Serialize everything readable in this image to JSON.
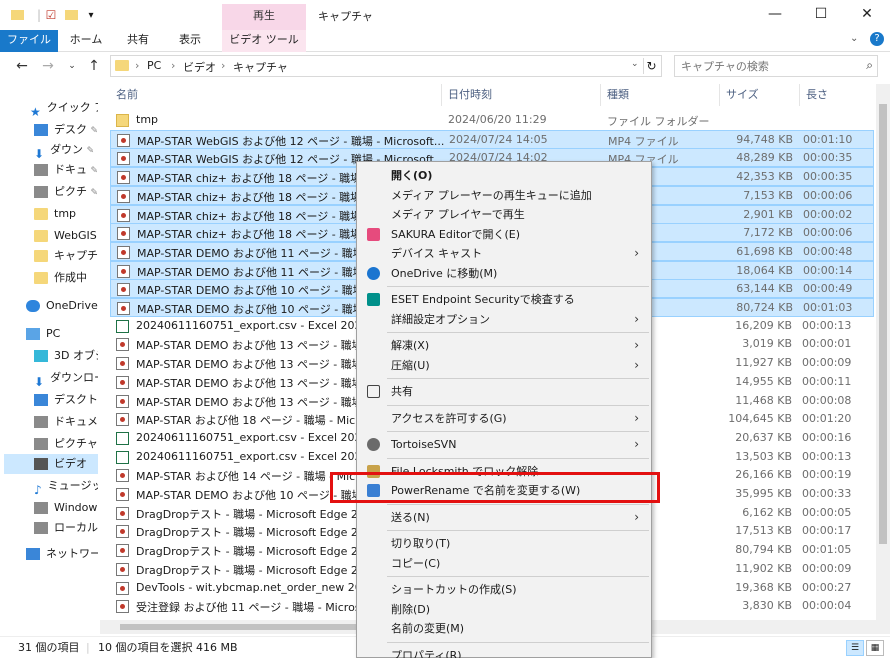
{
  "titlebar": {
    "title": "キャプチャ",
    "context_tab": "再生",
    "minimize": "—",
    "maximize": "☐",
    "close": "✕"
  },
  "ribbon": {
    "tabs": [
      "ファイル",
      "ホーム",
      "共有",
      "表示",
      "ビデオ ツール"
    ]
  },
  "address": {
    "crumbs": [
      "PC",
      "ビデオ",
      "キャプチャ"
    ],
    "search_placeholder": "キャプチャの検索"
  },
  "navpane": {
    "items": [
      {
        "label": "クイック ア",
        "icon": "star-icon"
      },
      {
        "label": "デスク",
        "icon": "desktop-icon"
      },
      {
        "label": "ダウン",
        "icon": "download-icon"
      },
      {
        "label": "ドキュ",
        "icon": "document-icon"
      },
      {
        "label": "ピクチ",
        "icon": "picture-icon"
      },
      {
        "label": "tmp",
        "icon": "folder-icon"
      },
      {
        "label": "WebGIS",
        "icon": "folder-icon"
      },
      {
        "label": "キャプチ",
        "icon": "folder-icon"
      },
      {
        "label": "作成中",
        "icon": "folder-icon"
      },
      {
        "label": "OneDrive",
        "icon": "onedrive-icon"
      },
      {
        "label": "PC",
        "icon": "pc-icon"
      },
      {
        "label": "3D オブジ",
        "icon": "cube-icon"
      },
      {
        "label": "ダウンロー",
        "icon": "download-icon"
      },
      {
        "label": "デスクトッ",
        "icon": "desktop-icon"
      },
      {
        "label": "ドキュメン",
        "icon": "document-icon"
      },
      {
        "label": "ピクチャ",
        "icon": "picture-icon"
      },
      {
        "label": "ビデオ",
        "icon": "video-icon"
      },
      {
        "label": "ミュージッ",
        "icon": "music-icon"
      },
      {
        "label": "Window",
        "icon": "drive-icon"
      },
      {
        "label": "ローカル",
        "icon": "drive-icon"
      },
      {
        "label": "ネットワーク",
        "icon": "network-icon"
      }
    ]
  },
  "columns": {
    "name": "名前",
    "date": "日付時刻",
    "type": "種類",
    "size": "サイズ",
    "length": "長さ"
  },
  "files": [
    {
      "name": "tmp",
      "date": "2024/06/20 11:29",
      "type": "ファイル フォルダー",
      "size": "",
      "len": "",
      "kind": "dir",
      "sel": false
    },
    {
      "name": "MAP-STAR WebGIS および他 12 ページ - 職場 - Microsoft...",
      "date": "2024/07/24 14:05",
      "type": "MP4 ファイル",
      "size": "94,748 KB",
      "len": "00:01:10",
      "kind": "mp4",
      "sel": true
    },
    {
      "name": "MAP-STAR WebGIS および他 12 ページ - 職場 - Microsoft...",
      "date": "2024/07/24 14:02",
      "type": "MP4 ファイル",
      "size": "48,289 KB",
      "len": "00:00:35",
      "kind": "mp4",
      "sel": true
    },
    {
      "name": "MAP-STAR chiz+ および他 18 ページ - 職場",
      "date": "",
      "type": "イル",
      "size": "42,353 KB",
      "len": "00:00:35",
      "kind": "mp4",
      "sel": true
    },
    {
      "name": "MAP-STAR chiz+ および他 18 ページ - 職場",
      "date": "",
      "type": "イル",
      "size": "7,153 KB",
      "len": "00:00:06",
      "kind": "mp4",
      "sel": true
    },
    {
      "name": "MAP-STAR chiz+ および他 18 ページ - 職場",
      "date": "",
      "type": "イル",
      "size": "2,901 KB",
      "len": "00:00:02",
      "kind": "mp4",
      "sel": true
    },
    {
      "name": "MAP-STAR chiz+ および他 18 ページ - 職場",
      "date": "",
      "type": "イル",
      "size": "7,172 KB",
      "len": "00:00:06",
      "kind": "mp4",
      "sel": true
    },
    {
      "name": "MAP-STAR DEMO および他 11 ページ - 職場",
      "date": "",
      "type": "イル",
      "size": "61,698 KB",
      "len": "00:00:48",
      "kind": "mp4",
      "sel": true
    },
    {
      "name": "MAP-STAR DEMO および他 11 ページ - 職場",
      "date": "",
      "type": "イル",
      "size": "18,064 KB",
      "len": "00:00:14",
      "kind": "mp4",
      "sel": true
    },
    {
      "name": "MAP-STAR DEMO および他 10 ページ - 職場",
      "date": "",
      "type": "イル",
      "size": "63,144 KB",
      "len": "00:00:49",
      "kind": "mp4",
      "sel": true
    },
    {
      "name": "MAP-STAR DEMO および他 10 ページ - 職場",
      "date": "",
      "type": "イル",
      "size": "80,724 KB",
      "len": "00:01:03",
      "kind": "mp4",
      "sel": true
    },
    {
      "name": "20240611160751_export.csv - Excel 2024-0",
      "date": "",
      "type": "イル",
      "size": "16,209 KB",
      "len": "00:00:13",
      "kind": "csv",
      "sel": false
    },
    {
      "name": "MAP-STAR DEMO および他 13 ページ - 職場",
      "date": "",
      "type": "イル",
      "size": "3,019 KB",
      "len": "00:00:01",
      "kind": "mp4",
      "sel": false
    },
    {
      "name": "MAP-STAR DEMO および他 13 ページ - 職場",
      "date": "",
      "type": "イル",
      "size": "11,927 KB",
      "len": "00:00:09",
      "kind": "mp4",
      "sel": false
    },
    {
      "name": "MAP-STAR DEMO および他 13 ページ - 職場",
      "date": "",
      "type": "イル",
      "size": "14,955 KB",
      "len": "00:00:11",
      "kind": "mp4",
      "sel": false
    },
    {
      "name": "MAP-STAR DEMO および他 13 ページ - 職場",
      "date": "",
      "type": "イル",
      "size": "11,468 KB",
      "len": "00:00:08",
      "kind": "mp4",
      "sel": false
    },
    {
      "name": "MAP-STAR および他 18 ページ - 職場 - Micro",
      "date": "",
      "type": "イル",
      "size": "104,645 KB",
      "len": "00:01:20",
      "kind": "mp4",
      "sel": false
    },
    {
      "name": "20240611160751_export.csv - Excel 2024-0",
      "date": "",
      "type": "イル",
      "size": "20,637 KB",
      "len": "00:00:16",
      "kind": "csv",
      "sel": false
    },
    {
      "name": "20240611160751_export.csv - Excel 2024-0",
      "date": "",
      "type": "イル",
      "size": "13,503 KB",
      "len": "00:00:13",
      "kind": "csv",
      "sel": false
    },
    {
      "name": "MAP-STAR および他 14 ページ - 職場 - Micro",
      "date": "",
      "type": "イル",
      "size": "26,166 KB",
      "len": "00:00:19",
      "kind": "mp4",
      "sel": false
    },
    {
      "name": "MAP-STAR DEMO および他 10 ページ - 職場",
      "date": "",
      "type": "イル",
      "size": "35,995 KB",
      "len": "00:00:33",
      "kind": "mp4",
      "sel": false
    },
    {
      "name": "DragDropテスト - 職場 - Microsoft Edge 202",
      "date": "",
      "type": "イル",
      "size": "6,162 KB",
      "len": "00:00:05",
      "kind": "mp4",
      "sel": false
    },
    {
      "name": "DragDropテスト - 職場 - Microsoft Edge 202",
      "date": "",
      "type": "イル",
      "size": "17,513 KB",
      "len": "00:00:17",
      "kind": "mp4",
      "sel": false
    },
    {
      "name": "DragDropテスト - 職場 - Microsoft Edge 202",
      "date": "",
      "type": "イル",
      "size": "80,794 KB",
      "len": "00:01:05",
      "kind": "mp4",
      "sel": false
    },
    {
      "name": "DragDropテスト - 職場 - Microsoft Edge 202",
      "date": "",
      "type": "イル",
      "size": "11,902 KB",
      "len": "00:00:09",
      "kind": "mp4",
      "sel": false
    },
    {
      "name": "DevTools - wit.ybcmap.net_order_new 202",
      "date": "",
      "type": "イル",
      "size": "19,368 KB",
      "len": "00:00:27",
      "kind": "mp4",
      "sel": false
    },
    {
      "name": "受注登録 および他 11 ページ - 職場 - Micros",
      "date": "",
      "type": "イル",
      "size": "3,830 KB",
      "len": "00:00:04",
      "kind": "mp4",
      "sel": false
    }
  ],
  "context_menu": {
    "items": [
      {
        "label": "開く(O)",
        "bold": true,
        "icon": "",
        "sub": false
      },
      {
        "label": "メディア プレーヤーの再生キューに追加",
        "icon": "",
        "sub": false
      },
      {
        "label": "メディア プレイヤーで再生",
        "icon": "",
        "sub": false
      },
      {
        "label": "SAKURA Editorで開く(E)",
        "icon": "sakura-icon",
        "sub": false
      },
      {
        "label": "デバイス キャスト",
        "icon": "",
        "sub": true
      },
      {
        "label": "OneDrive に移動(M)",
        "icon": "onedrive-icon",
        "sub": false
      },
      {
        "sep": true
      },
      {
        "label": "ESET Endpoint Securityで検査する",
        "icon": "eset-icon",
        "sub": false
      },
      {
        "label": "詳細設定オプション",
        "icon": "",
        "sub": true
      },
      {
        "sep": true
      },
      {
        "label": "解凍(X)",
        "icon": "",
        "sub": true
      },
      {
        "label": "圧縮(U)",
        "icon": "",
        "sub": true
      },
      {
        "sep": true
      },
      {
        "label": "共有",
        "icon": "share-icon",
        "sub": false
      },
      {
        "sep": true
      },
      {
        "label": "アクセスを許可する(G)",
        "icon": "",
        "sub": true
      },
      {
        "sep": true
      },
      {
        "label": "TortoiseSVN",
        "icon": "tortoisesvn-icon",
        "sub": true
      },
      {
        "sep": true
      },
      {
        "label": "File Locksmith でロック解除",
        "icon": "lock-icon",
        "sub": false
      },
      {
        "label": "PowerRename で名前を変更する(W)",
        "icon": "powerrename-icon",
        "sub": false
      },
      {
        "sep": true
      },
      {
        "label": "送る(N)",
        "icon": "",
        "sub": true
      },
      {
        "sep": true
      },
      {
        "label": "切り取り(T)",
        "icon": "",
        "sub": false
      },
      {
        "label": "コピー(C)",
        "icon": "",
        "sub": false
      },
      {
        "sep": true
      },
      {
        "label": "ショートカットの作成(S)",
        "icon": "",
        "sub": false
      },
      {
        "label": "削除(D)",
        "icon": "",
        "sub": false
      },
      {
        "label": "名前の変更(M)",
        "icon": "",
        "sub": false
      },
      {
        "sep": true
      },
      {
        "label": "プロパティ(R)",
        "icon": "",
        "sub": false
      }
    ]
  },
  "status": {
    "count": "31 個の項目",
    "selection": "10 個の項目を選択  416 MB"
  },
  "colors": {
    "selection": "#cce8ff",
    "file_tab": "#1979ca",
    "highlight": "#e31010"
  }
}
